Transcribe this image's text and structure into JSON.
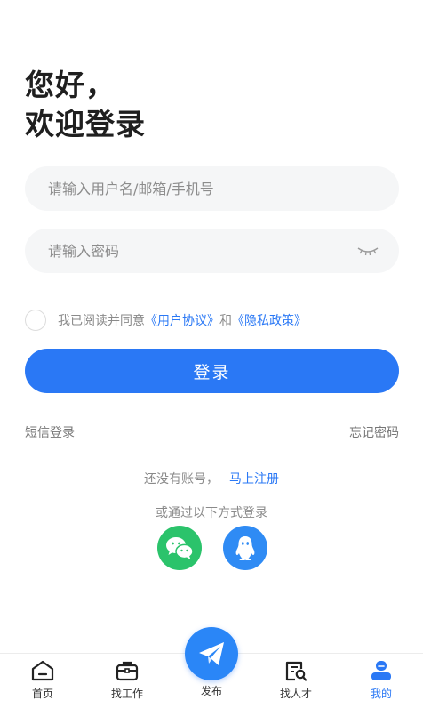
{
  "greeting": {
    "line1": "您好，",
    "line2": "欢迎登录"
  },
  "form": {
    "username_placeholder": "请输入用户名/邮箱/手机号",
    "password_placeholder": "请输入密码"
  },
  "agreement": {
    "prefix": "我已阅读并同意",
    "user_agreement": "《用户协议》",
    "and": "和",
    "privacy_policy": "《隐私政策》"
  },
  "login_button": "登录",
  "sms_login": "短信登录",
  "forgot_password": "忘记密码",
  "register": {
    "prompt": "还没有账号，",
    "link": "马上注册"
  },
  "other_methods": "或通过以下方式登录",
  "tabbar": {
    "home": "首页",
    "find_job": "找工作",
    "post": "发布",
    "find_talent": "找人才",
    "mine": "我的"
  },
  "colors": {
    "accent": "#2a78f5",
    "wechat": "#2bc36b",
    "qq": "#2f8bf4"
  },
  "icons": [
    "eye-closed-icon",
    "wechat-icon",
    "qq-icon",
    "home-icon",
    "briefcase-icon",
    "paper-plane-icon",
    "resume-search-icon",
    "user-icon"
  ]
}
